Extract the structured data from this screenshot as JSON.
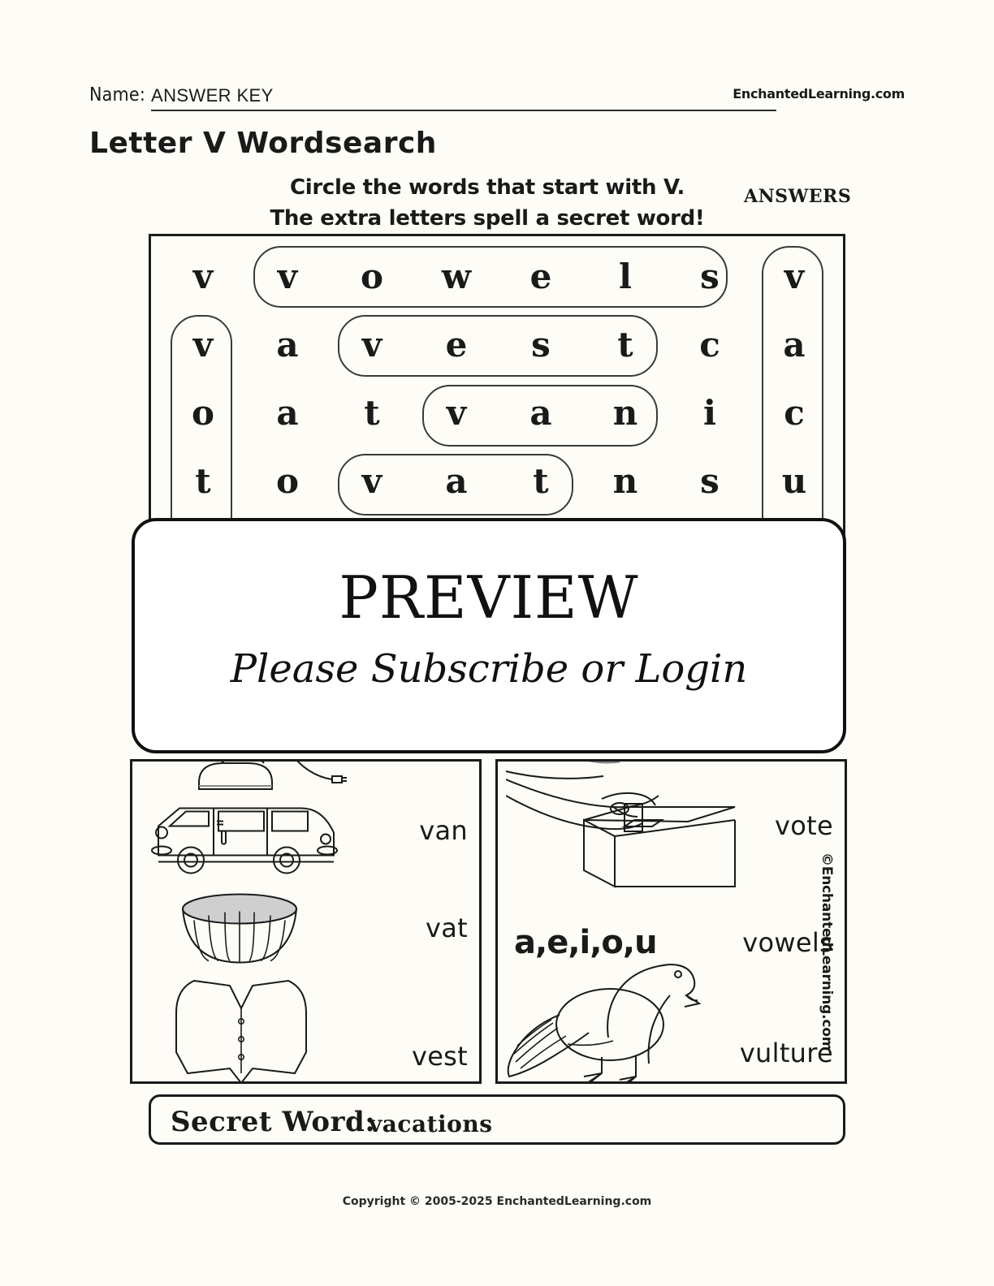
{
  "header": {
    "name_label": "Name:",
    "name_value": "ANSWER KEY",
    "brand": "EnchantedLearning.com"
  },
  "page_title": "Letter V Wordsearch",
  "instructions": {
    "line1": "Circle the words that start with V.",
    "line2": "The extra letters spell a secret word!",
    "answers_label": "ANSWERS"
  },
  "wordsearch": {
    "rows": [
      [
        "v",
        "v",
        "o",
        "w",
        "e",
        "l",
        "s",
        "v"
      ],
      [
        "v",
        "a",
        "v",
        "e",
        "s",
        "t",
        "c",
        "a"
      ],
      [
        "o",
        "a",
        "t",
        "v",
        "a",
        "n",
        "i",
        "c"
      ],
      [
        "t",
        "o",
        "v",
        "a",
        "t",
        "n",
        "s",
        "u"
      ]
    ],
    "circled_words": [
      {
        "word": "vowels",
        "direction": "horizontal",
        "row": 1,
        "col_start": 2,
        "col_end": 7
      },
      {
        "word": "vest",
        "direction": "horizontal",
        "row": 2,
        "col_start": 3,
        "col_end": 6
      },
      {
        "word": "van",
        "direction": "horizontal",
        "row": 3,
        "col_start": 4,
        "col_end": 6
      },
      {
        "word": "vat",
        "direction": "horizontal",
        "row": 4,
        "col_start": 3,
        "col_end": 5
      },
      {
        "word": "vote",
        "direction": "vertical",
        "col": 1,
        "row_start": 2,
        "row_end": 5
      },
      {
        "word": "vacuum",
        "direction": "vertical",
        "col": 8,
        "row_start": 1,
        "row_end": 6
      }
    ],
    "secret_word_letters": "vacations"
  },
  "pictures": {
    "left": [
      {
        "label": "van",
        "art": "van-illustration"
      },
      {
        "label": "vat",
        "art": "vat-illustration"
      },
      {
        "label": "vest",
        "art": "vest-illustration"
      }
    ],
    "right": [
      {
        "label": "vote",
        "art": "ballot-box-illustration"
      },
      {
        "label": "vowels",
        "art": "vowels-text",
        "text": "a,e,i,o,u"
      },
      {
        "label": "vulture",
        "art": "vulture-illustration"
      }
    ],
    "partial_top_left": "vacuum-illustration",
    "partial_top_right": "hand-illustration"
  },
  "side_watermark": "©EnchantedLearning.com",
  "secret_word": {
    "label": "Secret Word:",
    "value": "vacations"
  },
  "copyright": "Copyright © 2005-2025 EnchantedLearning.com",
  "preview_overlay": {
    "title": "PREVIEW",
    "subtitle": "Please Subscribe or Login"
  },
  "colors": {
    "page_background": "#fdfcf6",
    "ink": "#1a1a1a",
    "circle_stroke": "#3a3a3a",
    "overlay_background": "#ffffff"
  }
}
